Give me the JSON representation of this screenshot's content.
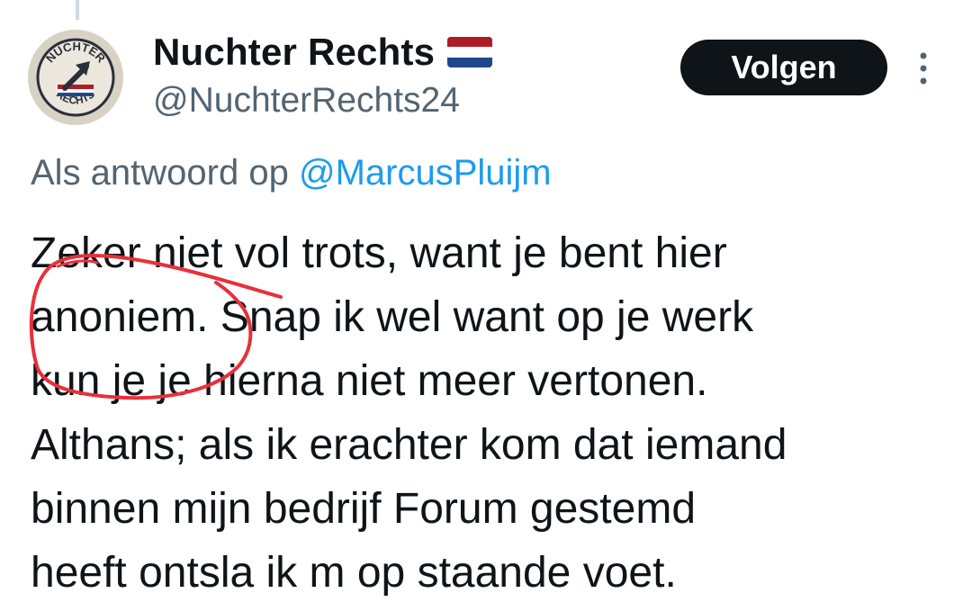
{
  "tweet": {
    "display_name": "Nuchter Rechts",
    "flag": "🇳🇱",
    "handle": "@NuchterRechts24",
    "follow_label": "Volgen",
    "reply_prefix": "Als antwoord op",
    "reply_mention": "@MarcusPluijm",
    "text_lines": [
      "Zeker niet vol trots, want je bent hier",
      "anoniem. Snap ik wel want op je werk",
      "kun je je hierna niet meer vertonen.",
      "Althans; als ik erachter kom dat iemand",
      "binnen mijn bedrijf Forum gestemd",
      "heeft ontsla ik m op staande voet."
    ]
  },
  "avatar": {
    "logo_top_text": "NUCHTER",
    "logo_bottom_text": "RECHTS",
    "icon": "arrow-up-right-icon"
  },
  "annotation": {
    "color": "#e8303a"
  },
  "icons": {
    "more": "more-vertical-icon"
  }
}
